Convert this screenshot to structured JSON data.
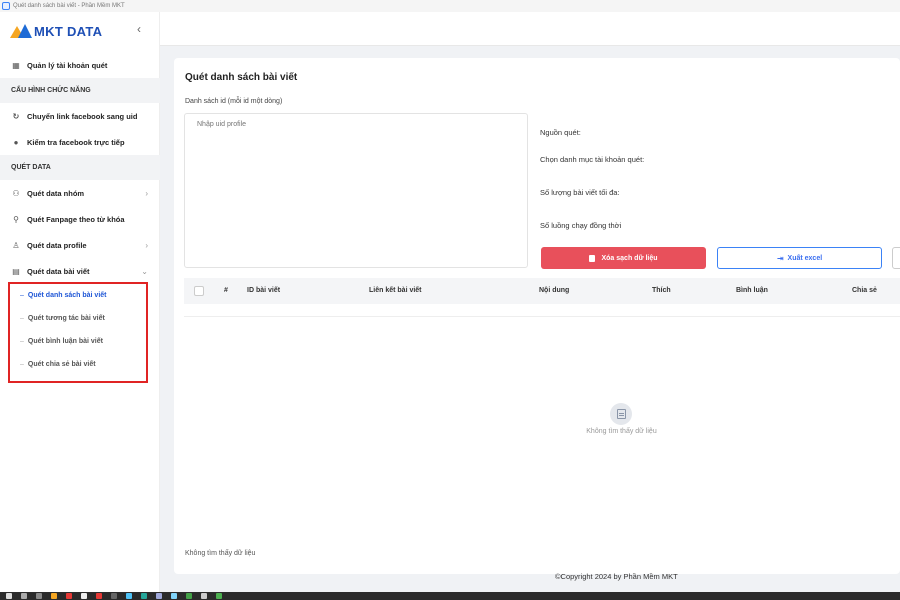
{
  "window": {
    "title": "Quét danh sách bài viết - Phần Mềm MKT"
  },
  "brand": {
    "logo_text": "MKT DATA",
    "colors": {
      "orange": "#f5a623",
      "blue": "#1e6bd6"
    }
  },
  "sidebar": {
    "collapse_icon": "chevron-left-icon",
    "top_item": {
      "label": "Quản lý tài khoản quét",
      "icon": "grid-icon"
    },
    "section_config": "CẤU HÌNH CHỨC NĂNG",
    "config_items": [
      {
        "label": "Chuyển link facebook sang uid",
        "icon": "refresh-icon"
      },
      {
        "label": "Kiểm tra facebook trực tiếp",
        "icon": "check-circle-icon"
      }
    ],
    "section_data": "QUÉT DATA",
    "data_items": [
      {
        "label": "Quét data nhóm",
        "icon": "group-icon",
        "chevron": "›"
      },
      {
        "label": "Quét Fanpage theo từ khóa",
        "icon": "search-icon"
      },
      {
        "label": "Quét data profile",
        "icon": "user-icon",
        "chevron": "›"
      },
      {
        "label": "Quét data bài viết",
        "icon": "document-icon",
        "chevron": "⌄"
      }
    ],
    "sub_items": [
      {
        "label": "Quét danh sách bài viết",
        "active": true
      },
      {
        "label": "Quét tương tác bài viết",
        "active": false
      },
      {
        "label": "Quét bình luận bài viết",
        "active": false
      },
      {
        "label": "Quét chia sẻ bài viết",
        "active": false
      }
    ],
    "highlight_color": "#e02424"
  },
  "main": {
    "title": "Quét danh sách bài viết",
    "uid_list_label": "Danh sách id (mỗi id một dòng)",
    "uid_placeholder": "Nhập uid profile",
    "fields": [
      "Nguồn quét:",
      "Chọn danh mục tài khoản quét:",
      "Số lượng bài viết tối đa:",
      "Số luồng chạy đồng thời"
    ],
    "buttons": {
      "clear": "Xóa sạch dữ liệu",
      "export": "Xuất excel"
    },
    "table": {
      "columns": [
        "#",
        "ID bài viết",
        "Liên kết bài viết",
        "Nội dung",
        "Thích",
        "Bình luận",
        "Chia sẻ"
      ],
      "empty_text": "Không tìm thấy dữ liệu"
    },
    "footer_text": "Không tìm thấy dữ liệu"
  },
  "copyright": "©Copyright 2024 by Phần Mềm MKT",
  "accent_colors": {
    "primary": "#1e56d6",
    "danger": "#e8505b"
  }
}
